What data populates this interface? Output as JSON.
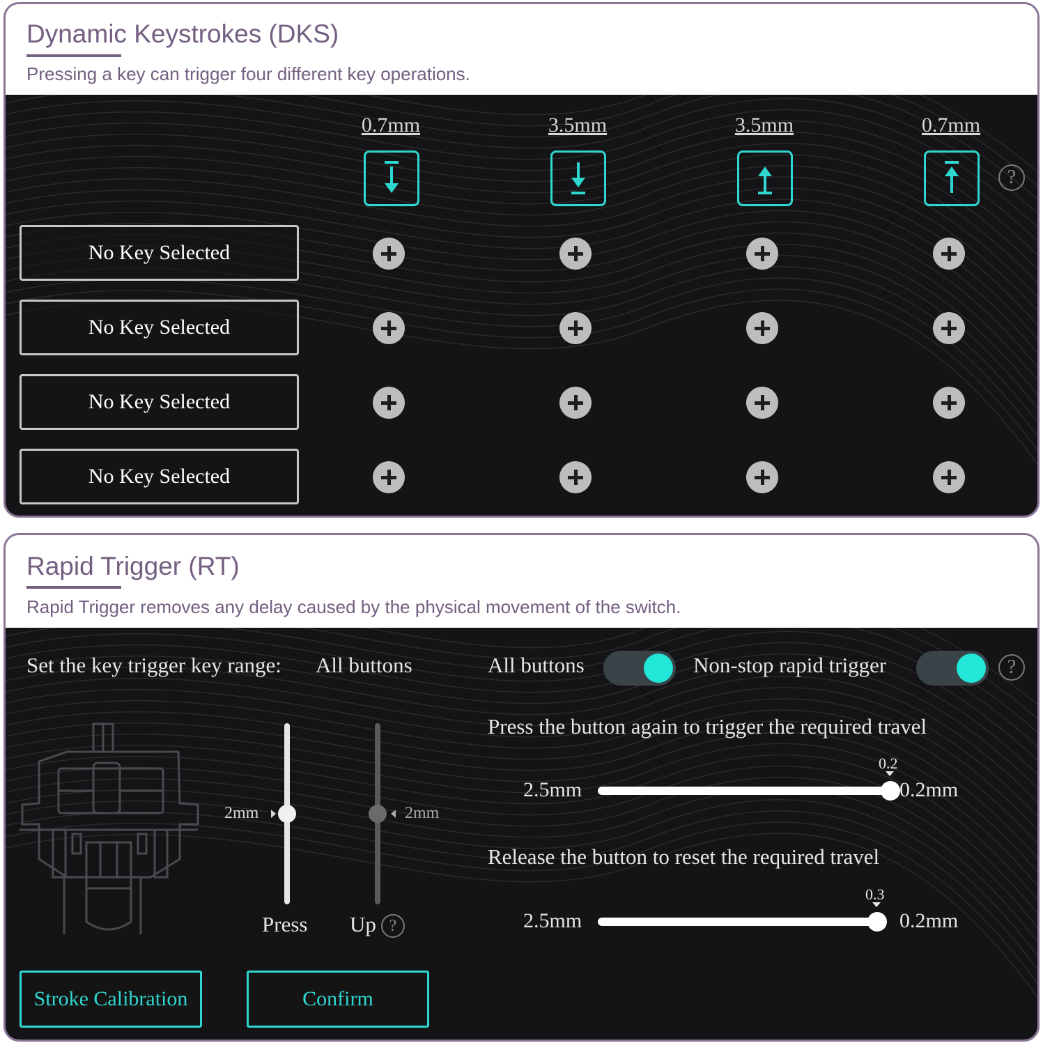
{
  "dks": {
    "title": "Dynamic Keystrokes (DKS)",
    "description": "Pressing a key can trigger four different key operations.",
    "columns": [
      {
        "distance": "0.7mm",
        "icon": "press-start-icon"
      },
      {
        "distance": "3.5mm",
        "icon": "press-bottom-icon"
      },
      {
        "distance": "3.5mm",
        "icon": "release-start-icon"
      },
      {
        "distance": "0.7mm",
        "icon": "release-top-icon"
      }
    ],
    "slots": [
      {
        "label": "No Key Selected"
      },
      {
        "label": "No Key Selected"
      },
      {
        "label": "No Key Selected"
      },
      {
        "label": "No Key Selected"
      }
    ],
    "help_glyph": "?"
  },
  "rt": {
    "title": "Rapid Trigger (RT)",
    "description": "Rapid Trigger removes any delay caused by the physical movement of the switch.",
    "range_label": "Set the key trigger key range:",
    "range_value": "All buttons",
    "all_buttons_label": "All buttons",
    "all_buttons_on": true,
    "nonstop_label": "Non-stop rapid trigger",
    "nonstop_on": true,
    "help_glyph": "?",
    "press_label": "Press",
    "up_label": "Up",
    "press_value": "2mm",
    "up_value": "2mm",
    "press_again_label": "Press the button again to trigger the required travel",
    "press_slider": {
      "min_label": "2.5mm",
      "max_label": "0.2mm",
      "value": "0.2",
      "fraction": 1.0
    },
    "release_label": "Release the button to reset the required travel",
    "release_slider": {
      "min_label": "2.5mm",
      "max_label": "0.2mm",
      "value": "0.3",
      "fraction": 0.957
    },
    "stroke_calibration": "Stroke Calibration",
    "confirm": "Confirm"
  },
  "colors": {
    "accent": "#2ed8d0",
    "frame": "#8a7596",
    "heading": "#735f80",
    "screen_bg": "#141416"
  }
}
